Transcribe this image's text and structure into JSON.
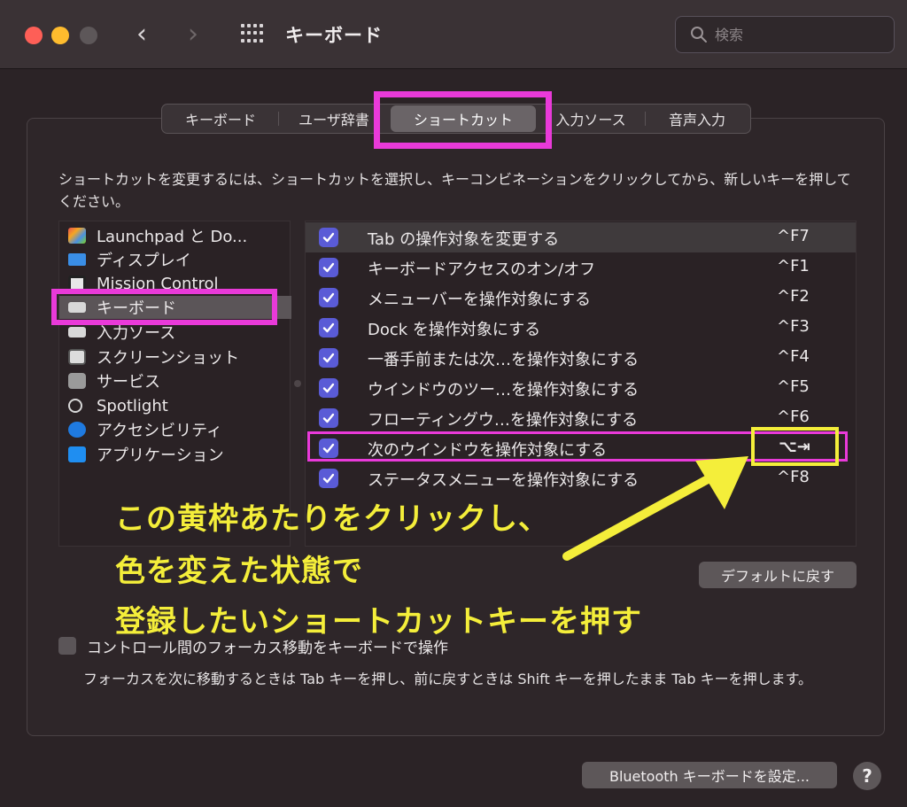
{
  "window": {
    "title": "キーボード",
    "search_placeholder": "検索"
  },
  "tabs": [
    {
      "label": "キーボード"
    },
    {
      "label": "ユーザ辞書"
    },
    {
      "label": "ショートカット",
      "active": true
    },
    {
      "label": "入力ソース"
    },
    {
      "label": "音声入力"
    }
  ],
  "instruction": "ショートカットを変更するには、ショートカットを選択し、キーコンビネーションをクリックしてから、新しいキーを押してください。",
  "categories": [
    {
      "label": "Launchpad と Do...",
      "icon": "launchpad-icon"
    },
    {
      "label": "ディスプレイ",
      "icon": "display-icon"
    },
    {
      "label": "Mission Control",
      "icon": "mission-control-icon"
    },
    {
      "label": "キーボード",
      "icon": "keyboard-icon",
      "selected": true
    },
    {
      "label": "入力ソース",
      "icon": "input-source-icon"
    },
    {
      "label": "スクリーンショット",
      "icon": "screenshot-icon"
    },
    {
      "label": "サービス",
      "icon": "services-icon"
    },
    {
      "label": "Spotlight",
      "icon": "spotlight-icon"
    },
    {
      "label": "アクセシビリティ",
      "icon": "accessibility-icon"
    },
    {
      "label": "アプリケーション",
      "icon": "app-store-icon"
    }
  ],
  "shortcuts": [
    {
      "label": "Tab の操作対象を変更する",
      "key": "^F7",
      "checked": true
    },
    {
      "label": "キーボードアクセスのオン/オフ",
      "key": "^F1",
      "checked": true
    },
    {
      "label": "メニューバーを操作対象にする",
      "key": "^F2",
      "checked": true
    },
    {
      "label": "Dock を操作対象にする",
      "key": "^F3",
      "checked": true
    },
    {
      "label": "一番手前または次…を操作対象にする",
      "key": "^F4",
      "checked": true
    },
    {
      "label": "ウインドウのツー…を操作対象にする",
      "key": "^F5",
      "checked": true
    },
    {
      "label": "フローティングウ…を操作対象にする",
      "key": "^F6",
      "checked": true
    },
    {
      "label": "次のウインドウを操作対象にする",
      "key": "⌥⇥",
      "checked": true
    },
    {
      "label": "ステータスメニューを操作対象にする",
      "key": "^F8",
      "checked": true
    }
  ],
  "annotation": {
    "line1": "この黄枠あたりをクリックし、",
    "line2": "色を変えた状態で",
    "line3": "登録したいショートカットキーを押す"
  },
  "buttons": {
    "restore_default": "デフォルトに戻す",
    "bluetooth": "Bluetooth キーボードを設定...",
    "help": "?"
  },
  "focus_checkbox": {
    "label": "コントロール間のフォーカス移動をキーボードで操作",
    "checked": false
  },
  "focus_description": "フォーカスを次に移動するときは Tab キーを押し、前に戻すときは Shift キーを押したまま Tab キーを押します。",
  "colors": {
    "highlight_magenta": "#e93ad9",
    "highlight_yellow": "#f4ee3a",
    "checkbox_accent": "#5a5bd6"
  }
}
